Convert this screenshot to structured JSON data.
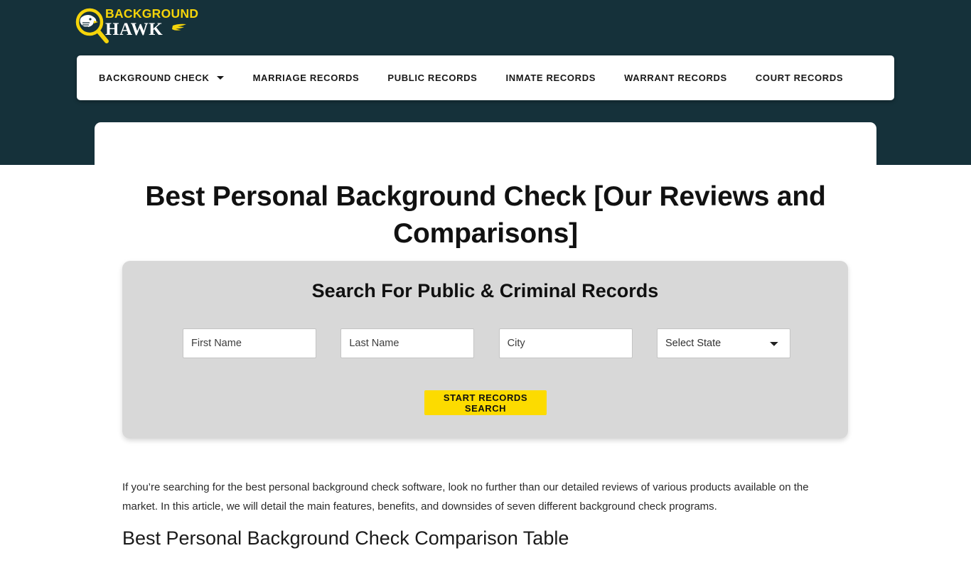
{
  "site": {
    "logo": {
      "line1": "BACKGROUND",
      "line2": "HAWK",
      "mark_icon": "magnifier-hawk-icon",
      "wing_icon": "wing-flourish-icon",
      "accent_color": "#f5d40a",
      "header_bg": "#15313a"
    }
  },
  "nav": {
    "items": [
      {
        "label": "BACKGROUND CHECK",
        "has_dropdown": true,
        "caret_icon": "chevron-down-icon"
      },
      {
        "label": "MARRIAGE RECORDS",
        "has_dropdown": false
      },
      {
        "label": "PUBLIC RECORDS",
        "has_dropdown": false
      },
      {
        "label": "INMATE RECORDS",
        "has_dropdown": false
      },
      {
        "label": "WARRANT RECORDS",
        "has_dropdown": false
      },
      {
        "label": "COURT RECORDS",
        "has_dropdown": false
      }
    ]
  },
  "page": {
    "title": "Best Personal Background Check [Our Reviews and Comparisons]"
  },
  "search": {
    "heading": "Search For Public & Criminal Records",
    "first_name_placeholder": "First Name",
    "last_name_placeholder": "Last Name",
    "city_placeholder": "City",
    "state_selected": "Select State",
    "state_options": [
      "Select State"
    ],
    "submit_label": "START RECORDS SEARCH",
    "submit_color": "#fcdb00",
    "panel_color": "#d8d8d8"
  },
  "article": {
    "paragraph": "If you’re searching for the best personal background check software, look no further than our detailed reviews of various products available on the market. In this article, we will detail the main features, benefits, and downsides of seven different background check programs.",
    "section_heading": "Best Personal Background Check Comparison Table"
  }
}
